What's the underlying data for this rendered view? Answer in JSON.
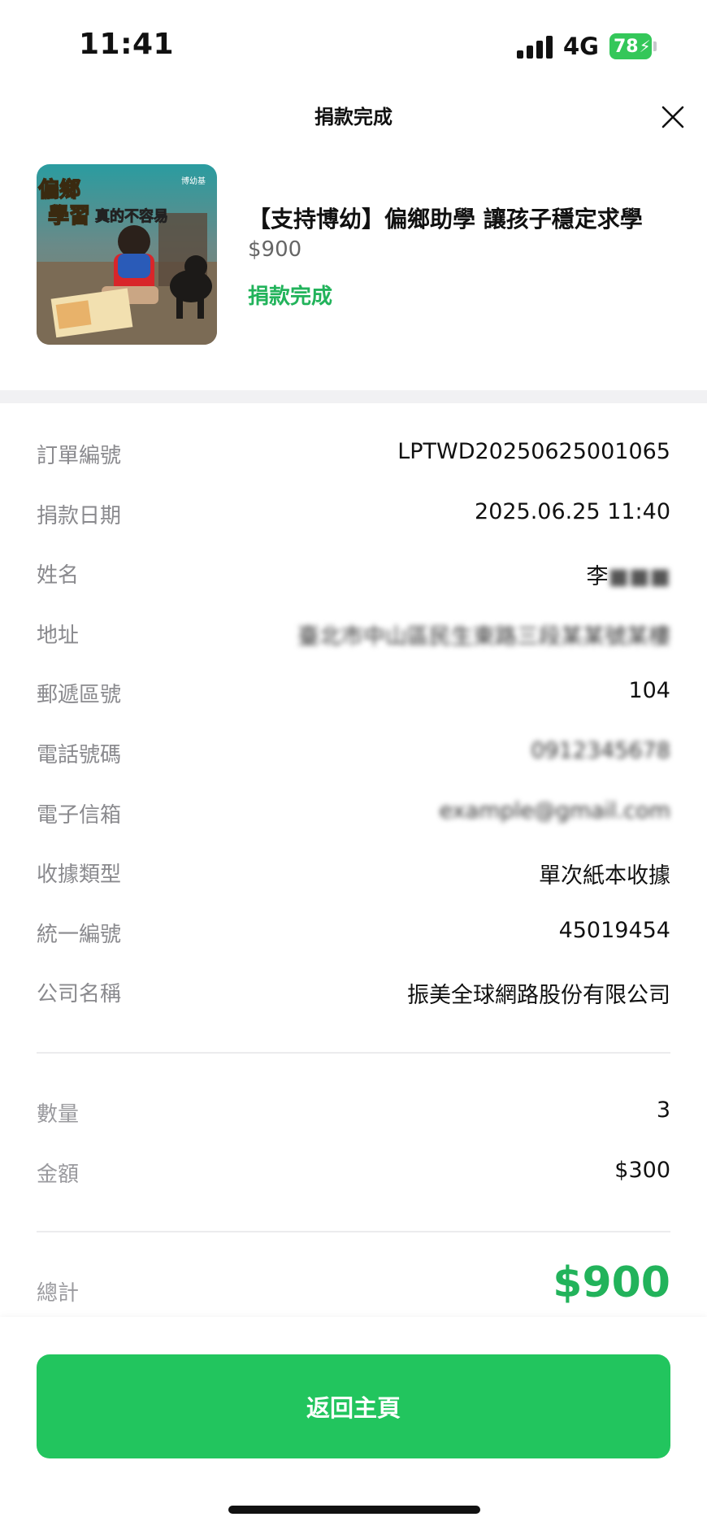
{
  "status_bar": {
    "time": "11:41",
    "network": "4G",
    "battery_level": "78",
    "battery_color": "#34c759"
  },
  "header": {
    "title": "捐款完成",
    "close_icon": "close-icon"
  },
  "product": {
    "image_icon": "campaign-thumbnail",
    "image_caption_line1": "偏鄉",
    "image_caption_line2": "學習",
    "image_caption_line3": "真的不容易",
    "image_brand": "博幼基",
    "title": "【支持博幼】偏鄉助學 讓孩子穩定求學",
    "price": "$900",
    "status": "捐款完成",
    "status_color": "#22b35b"
  },
  "details": [
    {
      "label": "訂單編號",
      "value": "LPTWD20250625001065",
      "blurred": false
    },
    {
      "label": "捐款日期",
      "value": "2025.06.25 11:40",
      "blurred": false
    },
    {
      "label": "姓名",
      "value": "李",
      "blurred_suffix": "■■■",
      "blurred": false
    },
    {
      "label": "地址",
      "value": "臺北市中山區民生東路三段某某號某樓",
      "blurred": true
    },
    {
      "label": "郵遞區號",
      "value": "104",
      "blurred": false
    },
    {
      "label": "電話號碼",
      "value": "0912345678",
      "blurred": true
    },
    {
      "label": "電子信箱",
      "value": "example@gmail.com",
      "blurred": true
    },
    {
      "label": "收據類型",
      "value": "單次紙本收據",
      "blurred": false
    },
    {
      "label": "統一編號",
      "value": "45019454",
      "blurred": false
    },
    {
      "label": "公司名稱",
      "value": "振美全球網路股份有限公司",
      "blurred": false
    }
  ],
  "summary": {
    "quantity_label": "數量",
    "quantity_value": "3",
    "amount_label": "金額",
    "amount_value": "$300",
    "total_label": "總計",
    "total_value": "$900"
  },
  "footer": {
    "home_button_label": "返回主頁",
    "accent_color": "#22c55e"
  }
}
